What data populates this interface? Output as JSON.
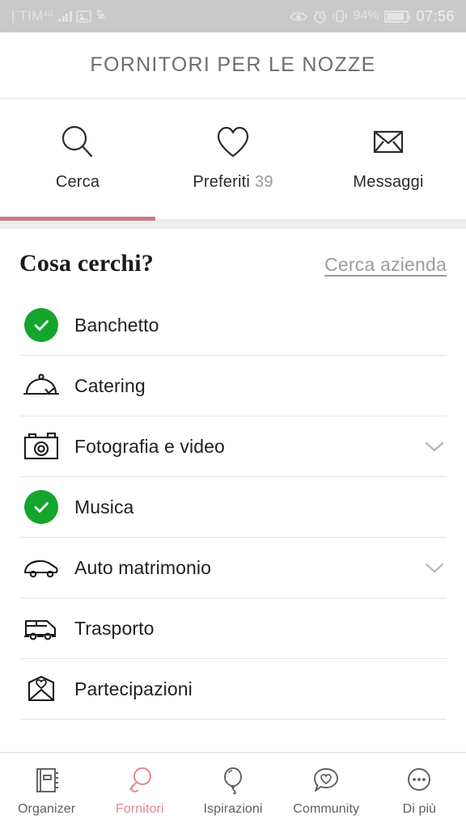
{
  "statusbar": {
    "carrier": "TIM",
    "network": "4G",
    "signal_icon": "signal-bars-icon",
    "photo_icon": "photo-icon",
    "sync_icon": "data-sync-icon",
    "eye_icon": "eye-comfort-icon",
    "alarm_icon": "alarm-clock-icon",
    "vibrate_icon": "vibrate-icon",
    "battery_percent": "94%",
    "battery_icon": "battery-icon",
    "time": "07:56"
  },
  "header": {
    "title": "FORNITORI PER LE NOZZE"
  },
  "tabs": {
    "active_index": 0,
    "accent_color": "#cc7a7f",
    "items": [
      {
        "label": "Cerca",
        "icon": "search-icon",
        "count": ""
      },
      {
        "label": "Preferiti",
        "icon": "heart-icon",
        "count": "39"
      },
      {
        "label": "Messaggi",
        "icon": "envelope-icon",
        "count": ""
      }
    ]
  },
  "main": {
    "section_title": "Cosa cerchi?",
    "section_link": "Cerca azienda",
    "selected_color": "#14a52c",
    "categories": [
      {
        "label": "Banchetto",
        "icon": "check-circle-icon",
        "selected": true,
        "expandable": false
      },
      {
        "label": "Catering",
        "icon": "food-cloche-icon",
        "selected": false,
        "expandable": false
      },
      {
        "label": "Fotografia e video",
        "icon": "camera-icon",
        "selected": false,
        "expandable": true
      },
      {
        "label": "Musica",
        "icon": "check-circle-icon",
        "selected": true,
        "expandable": false
      },
      {
        "label": "Auto matrimonio",
        "icon": "car-icon",
        "selected": false,
        "expandable": true
      },
      {
        "label": "Trasporto",
        "icon": "bus-icon",
        "selected": false,
        "expandable": false
      },
      {
        "label": "Partecipazioni",
        "icon": "envelope-heart-icon",
        "selected": false,
        "expandable": false
      }
    ]
  },
  "bottomnav": {
    "active_index": 1,
    "accent_color": "#e0868d",
    "items": [
      {
        "label": "Organizer",
        "icon": "notebook-icon"
      },
      {
        "label": "Fornitori",
        "icon": "magnifier-icon"
      },
      {
        "label": "Ispirazioni",
        "icon": "balloon-icon"
      },
      {
        "label": "Community",
        "icon": "speech-heart-icon"
      },
      {
        "label": "Di più",
        "icon": "more-dots-icon"
      }
    ]
  }
}
